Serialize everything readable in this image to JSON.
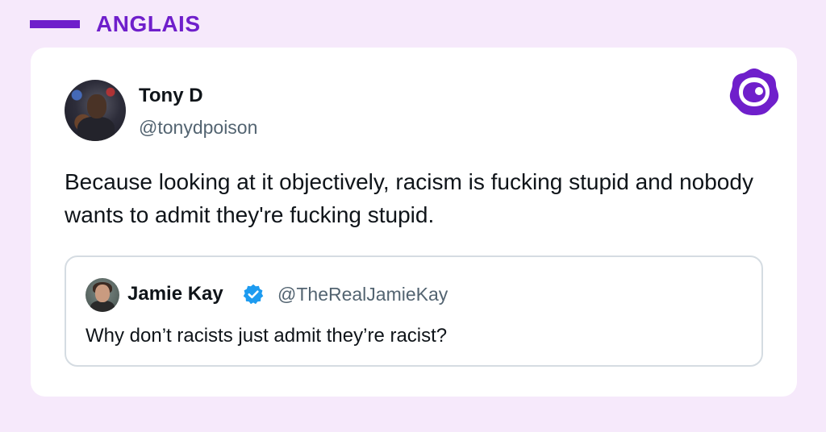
{
  "header": {
    "label": "ANGLAIS",
    "accent_color": "#6f1fcb"
  },
  "post": {
    "author_name": "Tony D",
    "author_handle": "@tonydpoison",
    "text": "Because looking at it objectively, racism is fucking stupid and nobody wants to admit they're fucking stupid.",
    "brand_icon": "purple-blob-logo-icon",
    "quoted": {
      "author_name": "Jamie Kay",
      "verified": true,
      "verified_icon": "verified-badge-icon",
      "author_handle": "@TheRealJamieKay",
      "text": "Why don’t racists just admit they’re racist?"
    }
  },
  "colors": {
    "background": "#f6e9fb",
    "card": "#ffffff",
    "verified_blue": "#1d9bf0"
  }
}
